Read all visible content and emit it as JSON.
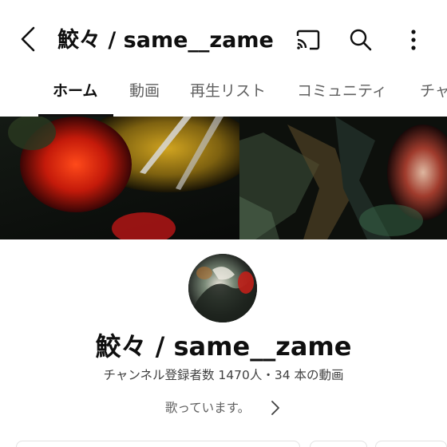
{
  "header": {
    "title": "鮫々 / same__zame",
    "back_icon": "chevron-left-icon",
    "cast_icon": "cast-icon",
    "search_icon": "search-icon",
    "more_icon": "more-vert-icon"
  },
  "tabs": [
    {
      "label": "ホーム",
      "active": true
    },
    {
      "label": "動画",
      "active": false
    },
    {
      "label": "再生リスト",
      "active": false
    },
    {
      "label": "コミュニティ",
      "active": false
    },
    {
      "label": "チャ",
      "active": false
    }
  ],
  "channel": {
    "name": "鮫々 / same__zame",
    "stats": "チャンネル登録者数 1470人・34 本の動画",
    "description": "歌っています。",
    "description_chevron_icon": "chevron-right-icon"
  },
  "colors": {
    "text_primary": "#0f0f0f",
    "text_secondary": "#606060",
    "background": "#ffffff"
  }
}
